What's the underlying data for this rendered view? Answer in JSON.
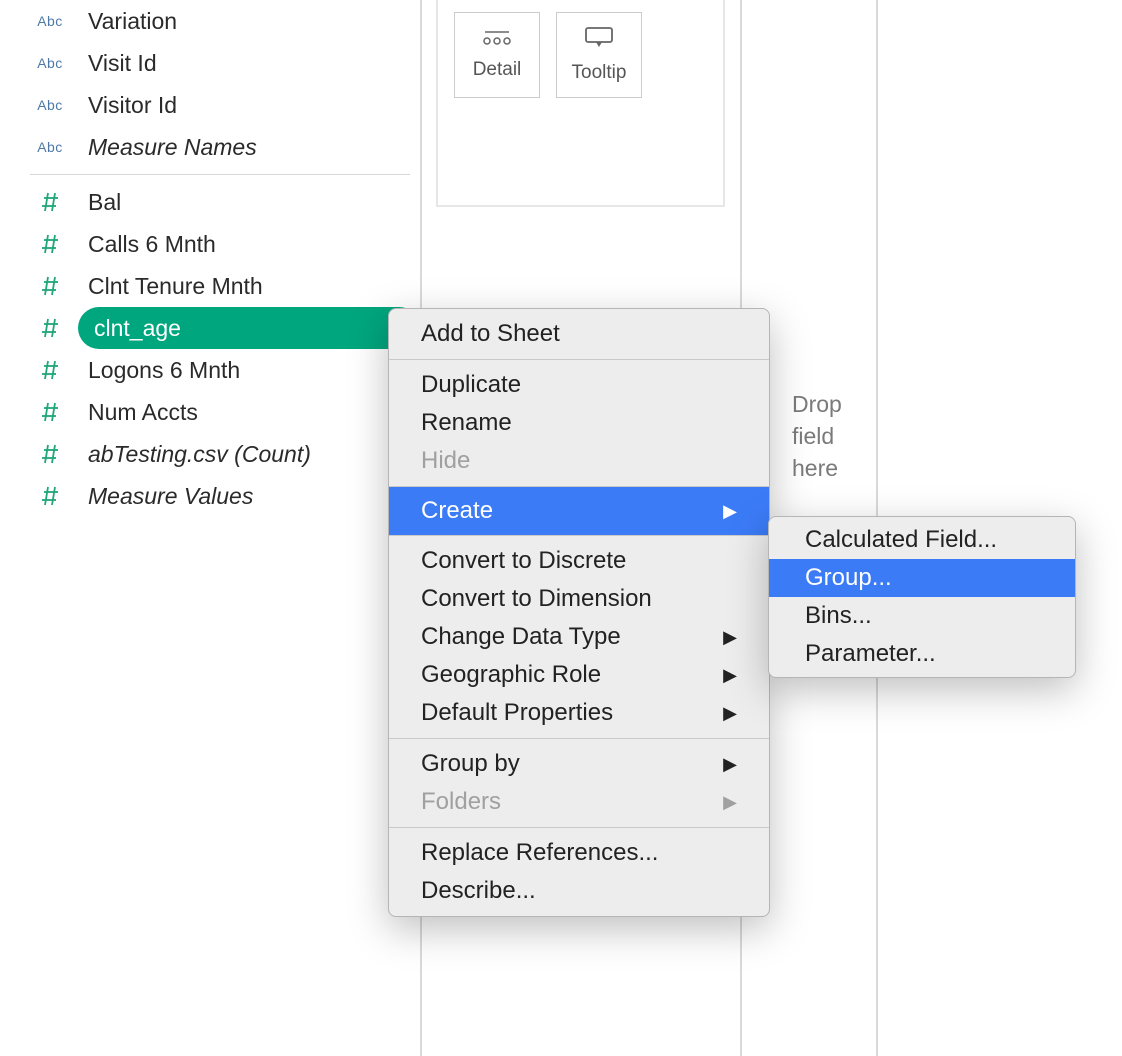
{
  "sidebar": {
    "dimension_fields": [
      {
        "label": "Variation"
      },
      {
        "label": "Visit Id"
      },
      {
        "label": "Visitor Id"
      },
      {
        "label": "Measure Names",
        "italic": true
      }
    ],
    "measure_fields": [
      {
        "label": "Bal"
      },
      {
        "label": "Calls 6 Mnth"
      },
      {
        "label": "Clnt Tenure Mnth"
      },
      {
        "label": "clnt_age",
        "selected": true
      },
      {
        "label": "Logons 6 Mnth"
      },
      {
        "label": "Num Accts"
      },
      {
        "label": "abTesting.csv (Count)",
        "italic": true
      },
      {
        "label": "Measure Values",
        "italic": true
      }
    ]
  },
  "marks": {
    "cards": [
      {
        "name": "detail",
        "label": "Detail"
      },
      {
        "name": "tooltip",
        "label": "Tooltip"
      }
    ]
  },
  "drop_hint": {
    "line1": "Drop",
    "line2": "field",
    "line3": "here"
  },
  "context_menu": {
    "sections": [
      [
        {
          "label": "Add to Sheet"
        }
      ],
      [
        {
          "label": "Duplicate"
        },
        {
          "label": "Rename"
        },
        {
          "label": "Hide",
          "disabled": true
        }
      ],
      [
        {
          "label": "Create",
          "arrow": true,
          "highlight": true
        }
      ],
      [
        {
          "label": "Convert to Discrete"
        },
        {
          "label": "Convert to Dimension"
        },
        {
          "label": "Change Data Type",
          "arrow": true
        },
        {
          "label": "Geographic Role",
          "arrow": true
        },
        {
          "label": "Default Properties",
          "arrow": true
        }
      ],
      [
        {
          "label": "Group by",
          "arrow": true
        },
        {
          "label": "Folders",
          "arrow": true,
          "disabled": true
        }
      ],
      [
        {
          "label": "Replace References..."
        },
        {
          "label": "Describe..."
        }
      ]
    ]
  },
  "submenu": {
    "items": [
      {
        "label": "Calculated Field..."
      },
      {
        "label": "Group...",
        "highlight": true
      },
      {
        "label": "Bins..."
      },
      {
        "label": "Parameter..."
      }
    ]
  }
}
